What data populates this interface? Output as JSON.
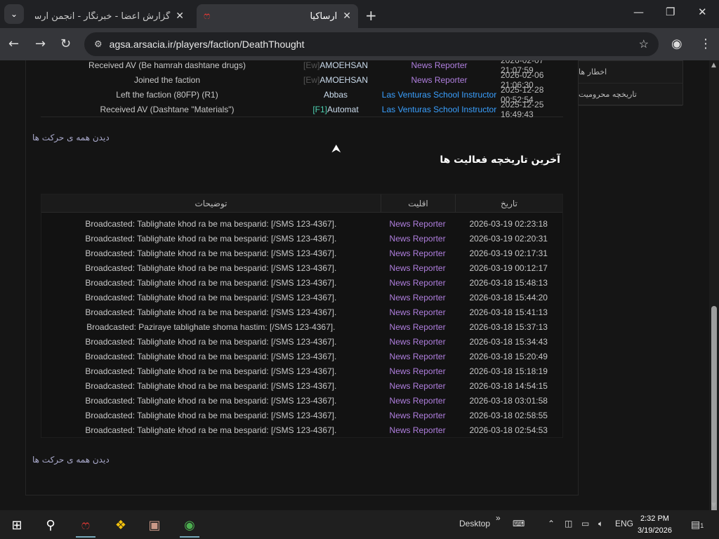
{
  "browser": {
    "tabs": [
      {
        "title": "گزارش اعضا - خبرنگار - انجمن آرساکیا",
        "active": false
      },
      {
        "title": "آرساکیا",
        "active": true
      }
    ],
    "url": "agsa.arsacia.ir/players/faction/DeathThought"
  },
  "sidebar": {
    "items": [
      "اخطار ها",
      "تاریخچه محرومیت"
    ]
  },
  "faction_history": {
    "rows": [
      {
        "desc": "Received AV (Be hamrah dashtane drugs)",
        "tag": "[Ew]",
        "player": "AMOEHSAN",
        "rank": "News Reporter",
        "date": "2026-02-07 21:07:59",
        "rank_color": "#b07fdf"
      },
      {
        "desc": "Joined the faction",
        "tag": "[Ew]",
        "player": "AMOEHSAN",
        "rank": "News Reporter",
        "date": "2026-02-06 21:06:30",
        "rank_color": "#b07fdf"
      },
      {
        "desc": "Left the faction (80FP) (R1)",
        "tag": "",
        "player": "Abbas",
        "rank": "Las Venturas School Instructor",
        "date": "2025-12-28 00:52:54",
        "rank_color": "#3aa0ff"
      },
      {
        "desc": "Received AV (Dashtane \"Materials\")",
        "tag": "[F1]",
        "player": "Automat",
        "rank": "Las Venturas School Instructor",
        "date": "2025-12-25 16:49:43",
        "rank_color": "#3aa0ff"
      }
    ],
    "view_all": "دیدن همه ی حرکت ها"
  },
  "activity": {
    "title": "آخرین تاریخچه فعالیت ها",
    "headers": {
      "desc": "توضیحات",
      "rank": "اقلیت",
      "date": "تاریخ"
    },
    "rows": [
      {
        "desc": "Broadcasted: Tablighate khod ra be ma besparid: [/SMS 123-4367].",
        "rank": "News Reporter",
        "date": "2026-03-19 02:23:18"
      },
      {
        "desc": "Broadcasted: Tablighate khod ra be ma besparid: [/SMS 123-4367].",
        "rank": "News Reporter",
        "date": "2026-03-19 02:20:31"
      },
      {
        "desc": "Broadcasted: Tablighate khod ra be ma besparid: [/SMS 123-4367].",
        "rank": "News Reporter",
        "date": "2026-03-19 02:17:31"
      },
      {
        "desc": "Broadcasted: Tablighate khod ra be ma besparid: [/SMS 123-4367].",
        "rank": "News Reporter",
        "date": "2026-03-19 00:12:17"
      },
      {
        "desc": "Broadcasted: Tablighate khod ra be ma besparid: [/SMS 123-4367].",
        "rank": "News Reporter",
        "date": "2026-03-18 15:48:13"
      },
      {
        "desc": "Broadcasted: Tablighate khod ra be ma besparid: [/SMS 123-4367].",
        "rank": "News Reporter",
        "date": "2026-03-18 15:44:20"
      },
      {
        "desc": "Broadcasted: Tablighate khod ra be ma besparid: [/SMS 123-4367].",
        "rank": "News Reporter",
        "date": "2026-03-18 15:41:13"
      },
      {
        "desc": "Broadcasted: Paziraye tablighate shoma hastim: [/SMS 123-4367].",
        "rank": "News Reporter",
        "date": "2026-03-18 15:37:13"
      },
      {
        "desc": "Broadcasted: Tablighate khod ra be ma besparid: [/SMS 123-4367].",
        "rank": "News Reporter",
        "date": "2026-03-18 15:34:43"
      },
      {
        "desc": "Broadcasted: Tablighate khod ra be ma besparid: [/SMS 123-4367].",
        "rank": "News Reporter",
        "date": "2026-03-18 15:20:49"
      },
      {
        "desc": "Broadcasted: Tablighate khod ra be ma besparid: [/SMS 123-4367].",
        "rank": "News Reporter",
        "date": "2026-03-18 15:18:19"
      },
      {
        "desc": "Broadcasted: Tablighate khod ra be ma besparid: [/SMS 123-4367].",
        "rank": "News Reporter",
        "date": "2026-03-18 14:54:15"
      },
      {
        "desc": "Broadcasted: Tablighate khod ra be ma besparid: [/SMS 123-4367].",
        "rank": "News Reporter",
        "date": "2026-03-18 03:01:58"
      },
      {
        "desc": "Broadcasted: Tablighate khod ra be ma besparid: [/SMS 123-4367].",
        "rank": "News Reporter",
        "date": "2026-03-18 02:58:55"
      },
      {
        "desc": "Broadcasted: Tablighate khod ra be ma besparid: [/SMS 123-4367].",
        "rank": "News Reporter",
        "date": "2026-03-18 02:54:53"
      }
    ],
    "view_all": "دیدن همه ی حرکت ها"
  },
  "taskbar": {
    "desktop_label": "Desktop",
    "language": "ENG",
    "time": "2:32 PM",
    "date": "3/19/2026",
    "notification_count": "1"
  }
}
